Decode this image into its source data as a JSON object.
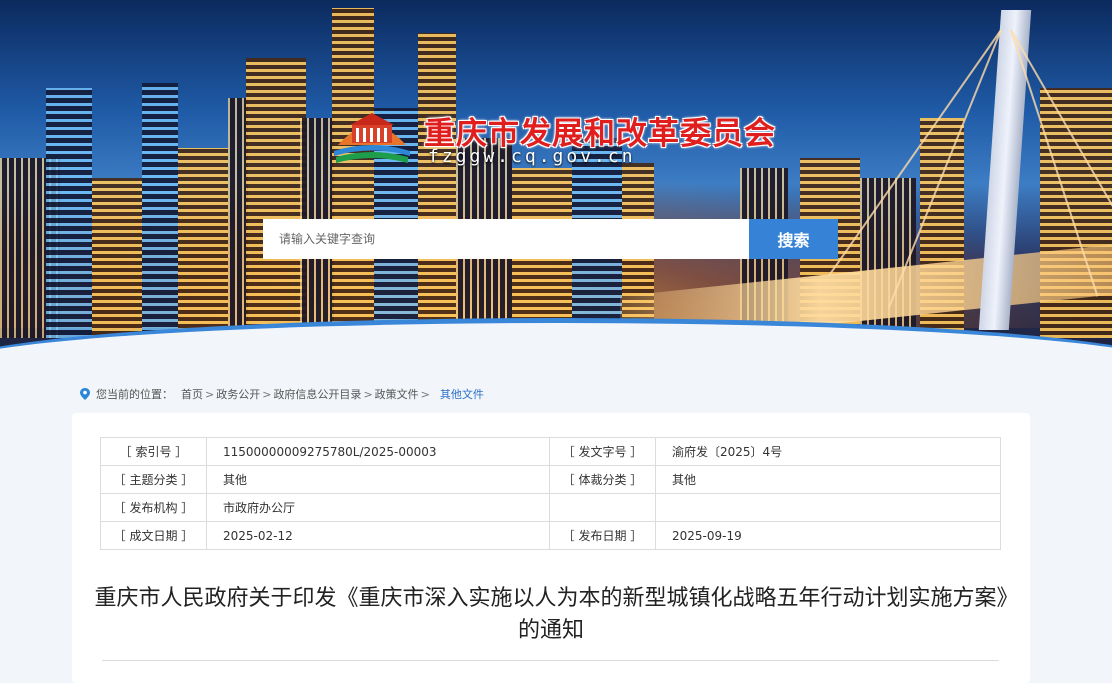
{
  "header": {
    "site_name": "重庆市发展和改革委员会",
    "site_domain": "fzggw.cq.gov.cn"
  },
  "search": {
    "placeholder": "请输入关键字查询",
    "button_label": "搜索"
  },
  "breadcrumb": {
    "prefix": "您当前的位置：",
    "items": [
      "首页",
      "政务公开",
      "政府信息公开目录",
      "政策文件"
    ],
    "current": "其他文件"
  },
  "meta": {
    "rows": [
      {
        "k1": "［ 索引号 ］",
        "v1": "11500000009275780L/2025-00003",
        "k2": "［ 发文字号 ］",
        "v2": "渝府发〔2025〕4号"
      },
      {
        "k1": "［ 主题分类 ］",
        "v1": "其他",
        "k2": "［ 体裁分类 ］",
        "v2": "其他"
      },
      {
        "k1": "［ 发布机构 ］",
        "v1": "市政府办公厅",
        "k2": "",
        "v2": ""
      },
      {
        "k1": "［ 成文日期 ］",
        "v1": "2025-02-12",
        "k2": "［ 发布日期 ］",
        "v2": "2025-09-19"
      }
    ]
  },
  "article": {
    "title": "重庆市人民政府关于印发《重庆市深入实施以人为本的新型城镇化战略五年行动计划实施方案》的通知"
  },
  "colors": {
    "accent": "#3582d6",
    "brand_red": "#e11e1e",
    "link_current": "#2a6fc9"
  }
}
